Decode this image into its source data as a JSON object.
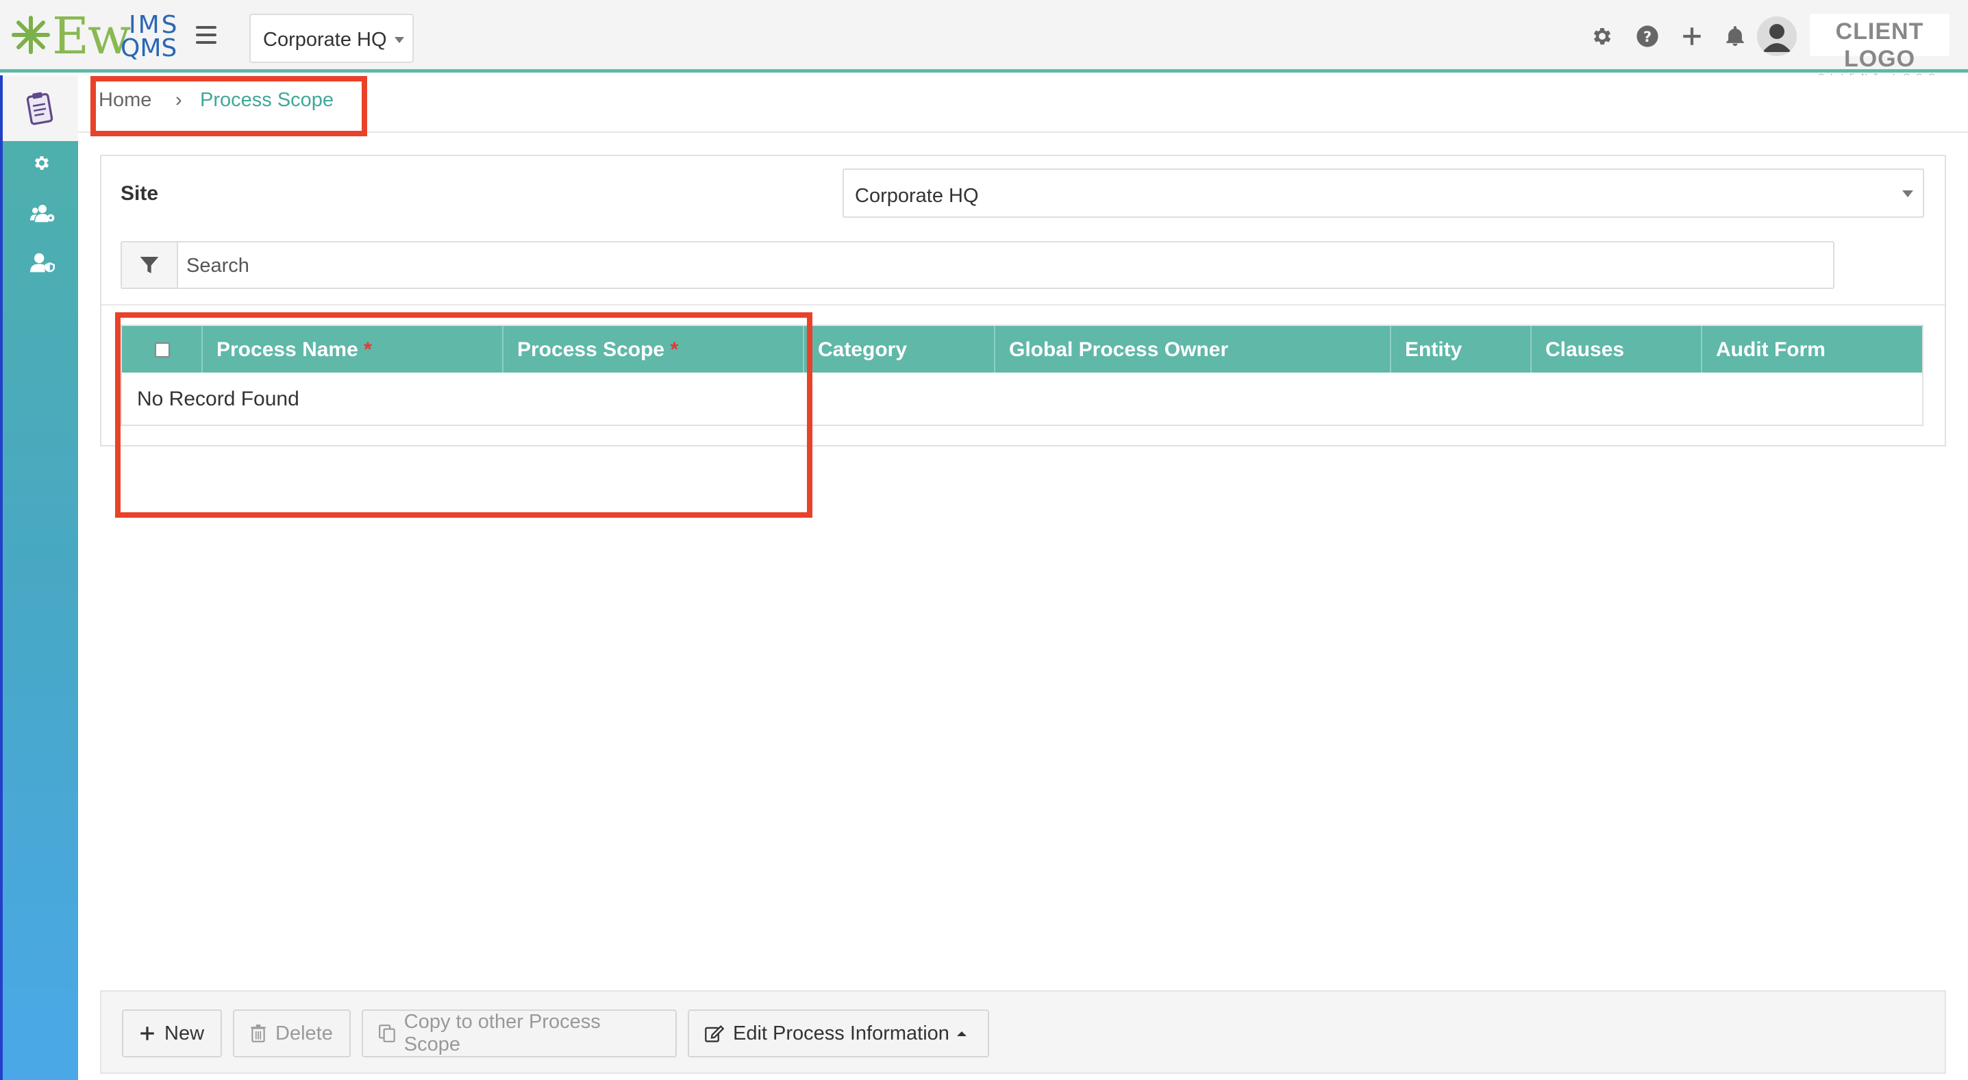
{
  "header": {
    "logo": {
      "ew": "Ew",
      "ims": "IMS",
      "qms": "QMS"
    },
    "site_selector": "Corporate HQ",
    "client_logo": {
      "main": "CLIENT LOGO",
      "sub": "CLIENT LOGO"
    },
    "icons": [
      "gear-icon",
      "help-icon",
      "plus-icon",
      "bell-icon",
      "avatar"
    ]
  },
  "sidebar": {
    "items": [
      {
        "icon": "clipboard-icon",
        "active": true
      },
      {
        "icon": "gear-icon"
      },
      {
        "icon": "users-gear-icon"
      },
      {
        "icon": "user-shield-icon"
      }
    ]
  },
  "breadcrumb": {
    "home": "Home",
    "separator": "›",
    "current": "Process Scope"
  },
  "form": {
    "site_label": "Site",
    "site_value": "Corporate HQ",
    "search_placeholder": "Search"
  },
  "grid": {
    "columns": [
      {
        "label": "Process Name",
        "required": "*"
      },
      {
        "label": "Process Scope",
        "required": "*"
      },
      {
        "label": "Category"
      },
      {
        "label": "Global Process Owner"
      },
      {
        "label": "Entity"
      },
      {
        "label": "Clauses"
      },
      {
        "label": "Audit Form"
      }
    ],
    "empty_text": "No Record Found"
  },
  "footer": {
    "new": "New",
    "delete": "Delete",
    "copy": "Copy to other Process Scope",
    "edit": "Edit Process Information"
  },
  "colors": {
    "accent": "#5fb8a8",
    "highlight": "#e8432a",
    "link": "#3fa89a"
  }
}
